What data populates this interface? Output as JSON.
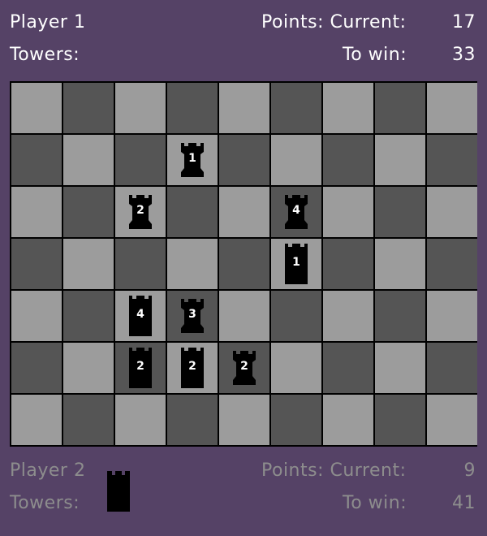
{
  "player1": {
    "name": "Player 1",
    "towers_label": "Towers:",
    "points_current_label": "Points: Current:",
    "points_current": "17",
    "to_win_label": "To win:",
    "to_win": "33"
  },
  "player2": {
    "name": "Player 2",
    "towers_label": "Towers:",
    "points_current_label": "Points: Current:",
    "points_current": "9",
    "to_win_label": "To win:",
    "to_win": "41",
    "towers_in_hand": 1
  },
  "board": {
    "columns": 9,
    "rows": 7,
    "colors": {
      "light": "#9c9c9c",
      "dark": "#555555",
      "grid": "#000000",
      "background": "#554266"
    },
    "pieces": [
      {
        "row": 1,
        "col": 3,
        "label": "1",
        "shape": "rook"
      },
      {
        "row": 2,
        "col": 2,
        "label": "2",
        "shape": "rook"
      },
      {
        "row": 2,
        "col": 5,
        "label": "4",
        "shape": "rook"
      },
      {
        "row": 3,
        "col": 5,
        "label": "1",
        "shape": "tower"
      },
      {
        "row": 4,
        "col": 2,
        "label": "4",
        "shape": "tower"
      },
      {
        "row": 4,
        "col": 3,
        "label": "3",
        "shape": "rook"
      },
      {
        "row": 5,
        "col": 2,
        "label": "2",
        "shape": "tower"
      },
      {
        "row": 5,
        "col": 3,
        "label": "2",
        "shape": "tower"
      },
      {
        "row": 5,
        "col": 4,
        "label": "2",
        "shape": "rook"
      }
    ]
  }
}
